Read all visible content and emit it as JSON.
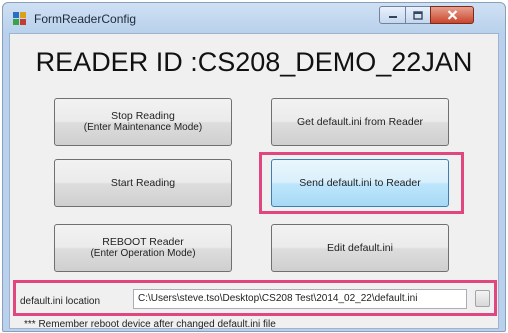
{
  "window": {
    "title": "FormReaderConfig",
    "controls": {
      "minimize": "minimize-icon",
      "maximize": "maximize-icon",
      "close": "close-icon"
    }
  },
  "reader_id": "READER ID :CS208_DEMO_22JAN",
  "buttons": {
    "stop_reading": {
      "line1": "Stop Reading",
      "line2": "(Enter Maintenance Mode)"
    },
    "get_default_ini": {
      "label": "Get default.ini from Reader"
    },
    "start_reading": {
      "label": "Start Reading"
    },
    "send_default_ini": {
      "label": "Send default.ini to Reader"
    },
    "reboot_reader": {
      "line1": "REBOOT Reader",
      "line2": "(Enter Operation Mode)"
    },
    "edit_default_ini": {
      "label": "Edit default.ini"
    }
  },
  "location": {
    "label": "default.ini location",
    "value": "C:\\Users\\steve.tso\\Desktop\\CS208 Test\\2014_02_22\\default.ini"
  },
  "note": "*** Remember reboot device after changed default.ini file",
  "colors": {
    "highlight": "#e0467f",
    "titlebar": "#b9d1ec",
    "close": "#c9452c"
  }
}
